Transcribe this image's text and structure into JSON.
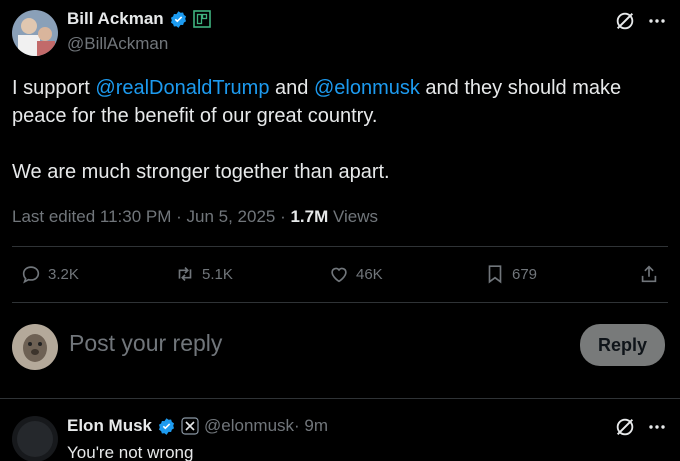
{
  "main_tweet": {
    "author_name": "Bill Ackman",
    "author_handle": "@BillAckman",
    "text_parts": {
      "p1_prefix": "I support ",
      "mention1": "@realDonaldTrump",
      "p1_mid": " and ",
      "mention2": "@elonmusk",
      "p1_suffix": " and they should make peace for the benefit of our great country.",
      "p2": "We are much stronger together than apart."
    },
    "meta": {
      "edited": "Last edited 11:30 PM · Jun 5, 2025 · ",
      "views_count": "1.7M",
      "views_label": " Views"
    }
  },
  "actions": {
    "replies": "3.2K",
    "reposts": "5.1K",
    "likes": "46K",
    "bookmarks": "679"
  },
  "composer": {
    "placeholder": "Post your reply",
    "button_label": "Reply"
  },
  "reply_tweet": {
    "author_name": "Elon Musk",
    "author_handle": "@elonmusk",
    "time": " · 9m",
    "text": "You're not wrong"
  },
  "colors": {
    "background": "#000000",
    "accent": "#1d9bf0",
    "muted": "#71767b",
    "divider": "#2f3336"
  }
}
